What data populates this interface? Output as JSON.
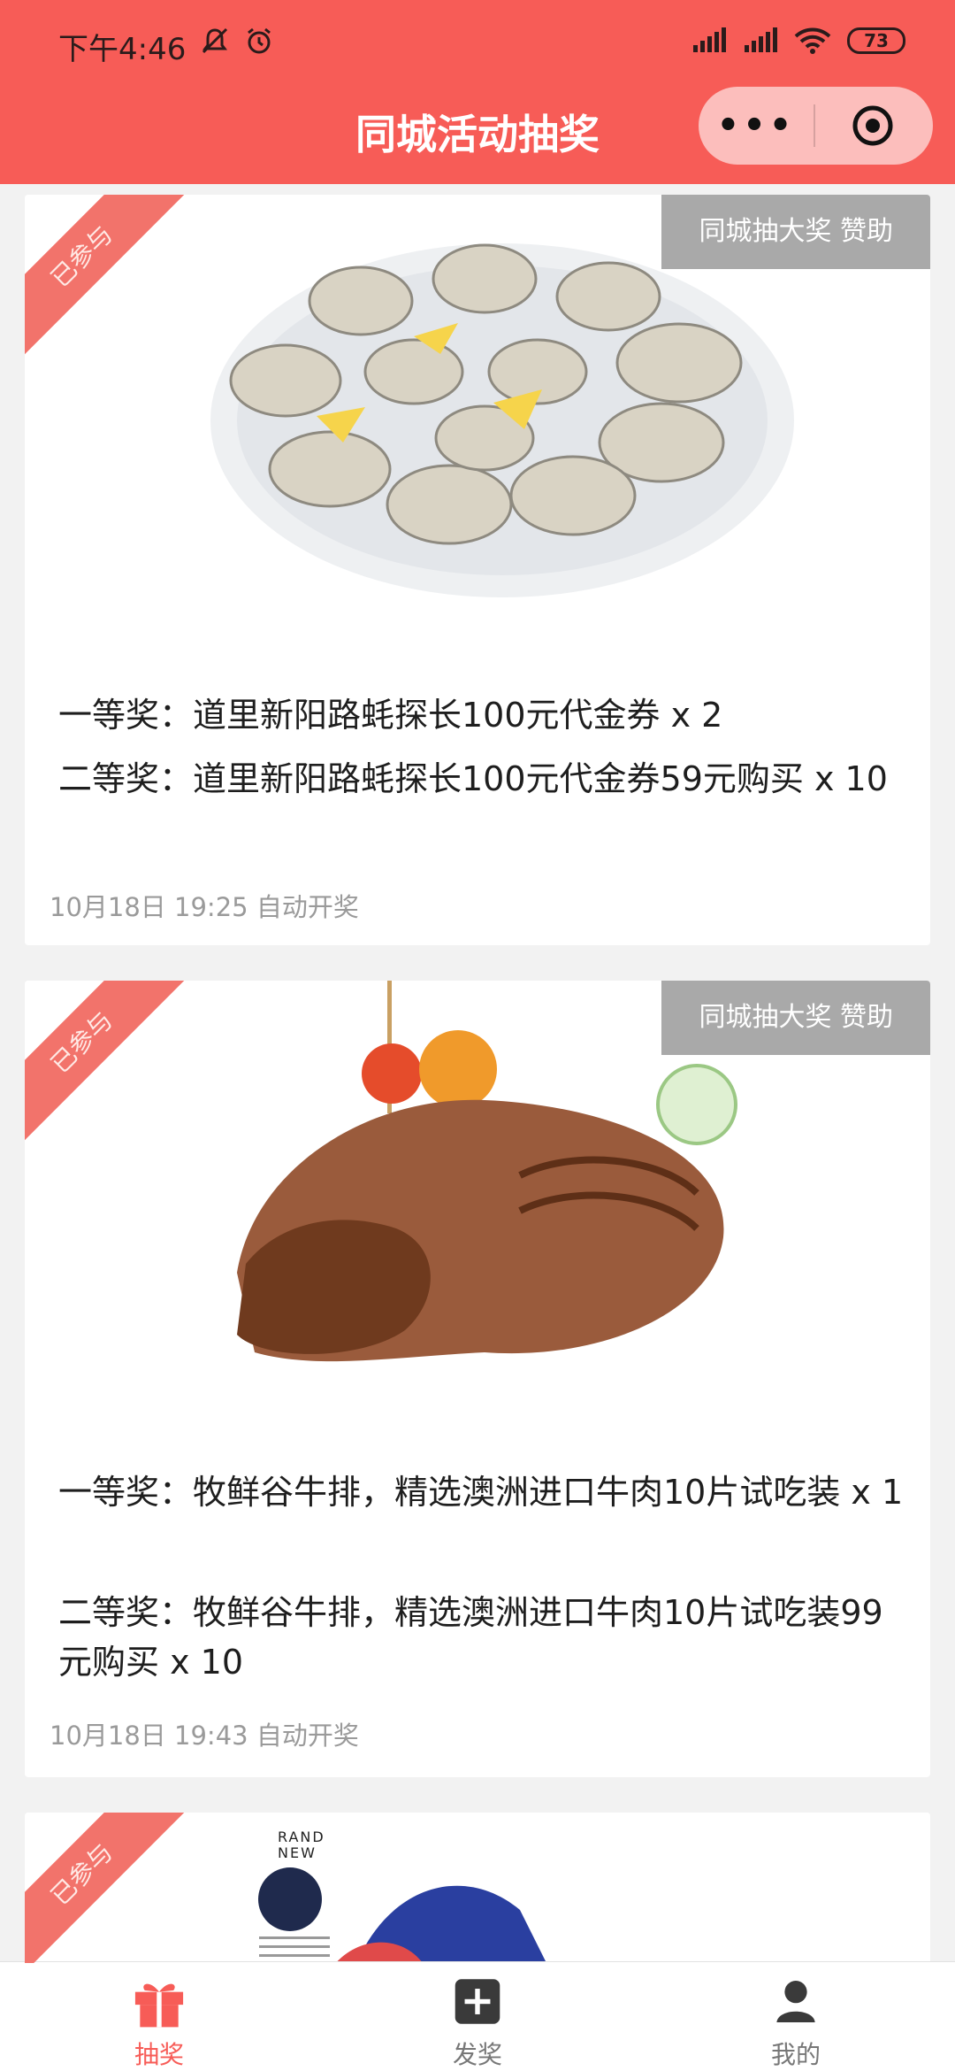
{
  "status_bar": {
    "time": "下午4:46",
    "battery": "73",
    "icons": [
      "mute-icon",
      "alarm-icon",
      "signal-icon",
      "signal-icon",
      "wifi-icon",
      "battery-icon"
    ]
  },
  "navbar": {
    "title": "同城活动抽奖",
    "capsule_more": "•••"
  },
  "feed": {
    "cards": [
      {
        "badge": "已参与",
        "sponsor": "同城抽大奖 赞助",
        "prize_1": "一等奖：道里新阳路蚝探长100元代金券 x 2",
        "prize_2": "二等奖：道里新阳路蚝探长100元代金券59元购买 x 10",
        "draw_time": "10月18日 19:25 自动开奖"
      },
      {
        "badge": "已参与",
        "sponsor": "同城抽大奖 赞助",
        "prize_1": "一等奖：牧鲜谷牛排，精选澳洲进口牛肉10片试吃装 x 1",
        "prize_2": "二等奖：牧鲜谷牛排，精选澳洲进口牛肉10片试吃装99元购买 x 10",
        "draw_time": "10月18日 19:43 自动开奖"
      },
      {
        "badge": "已参与",
        "image_text_1": "RAND",
        "image_text_2": "NEW"
      }
    ]
  },
  "tabbar": {
    "tabs": [
      {
        "label": "抽奖",
        "icon": "gift-icon",
        "active": true
      },
      {
        "label": "发奖",
        "icon": "plus-icon",
        "active": false
      },
      {
        "label": "我的",
        "icon": "user-icon",
        "active": false
      }
    ]
  },
  "colors": {
    "brand": "#f75c57",
    "ribbon": "#f2736b",
    "sponsor_bg": "#8c8c8c"
  }
}
